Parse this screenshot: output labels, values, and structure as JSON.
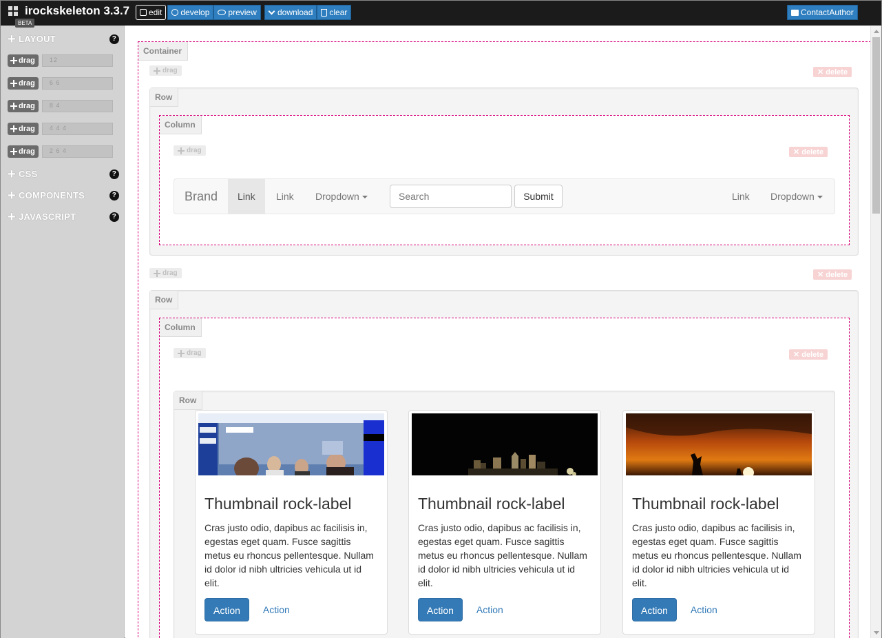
{
  "app": {
    "title": "irockskeleton 3.3.7",
    "badge": "BETA"
  },
  "toolbar": {
    "edit": "edit",
    "develop": "develop",
    "preview": "preview",
    "download": "download",
    "clear": "clear",
    "contact": "ContactAuthor"
  },
  "sidebar": {
    "sections": [
      {
        "label": "LAYOUT",
        "help": "?"
      },
      {
        "label": "CSS",
        "help": "?"
      },
      {
        "label": "COMPONENTS",
        "help": "?"
      },
      {
        "label": "JAVASCRIPT",
        "help": "?"
      }
    ],
    "layouts": [
      {
        "drag": "drag",
        "value": "12"
      },
      {
        "drag": "drag",
        "value": "6 6"
      },
      {
        "drag": "drag",
        "value": "8 4"
      },
      {
        "drag": "drag",
        "value": "4 4 4"
      },
      {
        "drag": "drag",
        "value": "2 6 4"
      }
    ]
  },
  "canvas": {
    "container_label": "Container",
    "row_label": "Row",
    "column_label": "Column",
    "drag": "drag",
    "delete": "delete",
    "navbar": {
      "brand": "Brand",
      "link_active": "Link",
      "link": "Link",
      "dropdown": "Dropdown",
      "search_placeholder": "Search",
      "submit": "Submit",
      "right_link": "Link",
      "right_dropdown": "Dropdown"
    },
    "thumbnails": [
      {
        "title": "Thumbnail rock-label",
        "body": "Cras justo odio, dapibus ac facilisis in, egestas eget quam. Fusce sagittis metus eu rhoncus pellentesque. Nullam id dolor id nibh ultricies vehicula ut id elit.",
        "primary": "Action",
        "secondary": "Action"
      },
      {
        "title": "Thumbnail rock-label",
        "body": "Cras justo odio, dapibus ac facilisis in, egestas eget quam. Fusce sagittis metus eu rhoncus pellentesque. Nullam id dolor id nibh ultricies vehicula ut id elit.",
        "primary": "Action",
        "secondary": "Action"
      },
      {
        "title": "Thumbnail rock-label",
        "body": "Cras justo odio, dapibus ac facilisis in, egestas eget quam. Fusce sagittis metus eu rhoncus pellentesque. Nullam id dolor id nibh ultricies vehicula ut id elit.",
        "primary": "Action",
        "secondary": "Action"
      }
    ]
  },
  "colors": {
    "accent": "#337ab7",
    "dashed": "#d6007a",
    "topbar": "#1b1b1b",
    "sidebar": "#d3d3d3"
  }
}
